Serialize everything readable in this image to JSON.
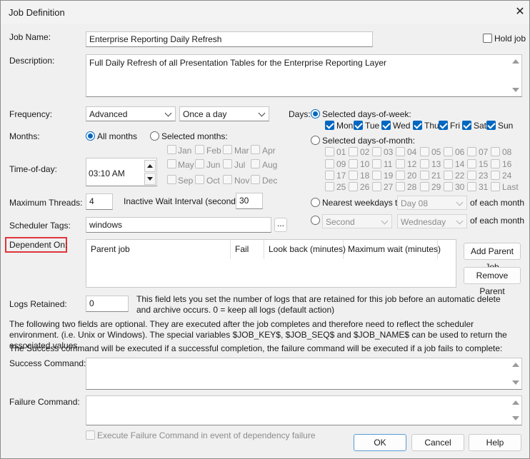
{
  "window": {
    "title": "Job Definition",
    "close_glyph": "✕"
  },
  "job_name": {
    "label": "Job Name:",
    "value": "Enterprise Reporting Daily Refresh"
  },
  "hold_job": {
    "label": "Hold job",
    "checked": false
  },
  "description": {
    "label": "Description:",
    "value": "Full Daily Refresh of all Presentation Tables for the Enterprise Reporting Layer"
  },
  "frequency": {
    "label": "Frequency:",
    "mode": "Advanced",
    "period": "Once a day"
  },
  "months": {
    "label": "Months:",
    "all_label": "All months",
    "selected_label": "Selected months:",
    "list": [
      "Jan",
      "Feb",
      "Mar",
      "Apr",
      "May",
      "Jun",
      "Jul",
      "Aug",
      "Sep",
      "Oct",
      "Nov",
      "Dec"
    ]
  },
  "time_of_day": {
    "label": "Time-of-day:",
    "value": "03:10 AM"
  },
  "max_threads": {
    "label": "Maximum Threads:",
    "value": "4"
  },
  "inactive_wait": {
    "label": "Inactive Wait Interval (seconds):",
    "value": "30"
  },
  "scheduler_tags": {
    "label": "Scheduler Tags:",
    "value": "windows",
    "browse_label": "..."
  },
  "days": {
    "label": "Days:",
    "week_label": "Selected days-of-week:",
    "weekdays": [
      "Mon",
      "Tue",
      "Wed",
      "Thu",
      "Fri",
      "Sat",
      "Sun"
    ],
    "month_label": "Selected days-of-month:",
    "month_days": [
      "01",
      "02",
      "03",
      "04",
      "05",
      "06",
      "07",
      "08",
      "09",
      "10",
      "11",
      "12",
      "13",
      "14",
      "15",
      "16",
      "17",
      "18",
      "19",
      "20",
      "21",
      "22",
      "23",
      "24",
      "25",
      "26",
      "27",
      "28",
      "29",
      "30",
      "31",
      "Last"
    ],
    "nearest_label": "Nearest weekdays to",
    "nearest_value": "Day 08",
    "of_each_month": "of each month",
    "ordinal_value": "Second",
    "weekday_value": "Wednesday"
  },
  "dependent_on": {
    "label": "Dependent On:",
    "columns": [
      "Parent job",
      "Fail",
      "Look back (minutes)",
      "Maximum wait (minutes)"
    ],
    "add_label": "Add Parent Job",
    "remove_label": "Remove Parent"
  },
  "logs": {
    "label": "Logs Retained:",
    "value": "0",
    "help": "This field lets you set the number of logs that are retained for this job before an automatic delete and archive occurs. 0 = keep all logs (default action)"
  },
  "info": {
    "optional": "The following two fields are optional. They are executed after the job completes and therefore need to reflect the scheduler environment. (i.e. Unix or Windows). The special variables $JOB_KEY$, $JOB_SEQ$ and $JOB_NAME$ can be used to return the associated values.",
    "success_fail": "The Success command will be executed if a successful completion, the failure command will be executed if a job fails to complete:"
  },
  "success_command": {
    "label": "Success Command:",
    "value": ""
  },
  "failure_command": {
    "label": "Failure Command:",
    "value": ""
  },
  "exec_failure": {
    "label": "Execute Failure Command in event of dependency failure"
  },
  "buttons": {
    "ok": "OK",
    "cancel": "Cancel",
    "help": "Help"
  },
  "colors": {
    "accent": "#0067c0",
    "highlight": "#e0353b"
  }
}
